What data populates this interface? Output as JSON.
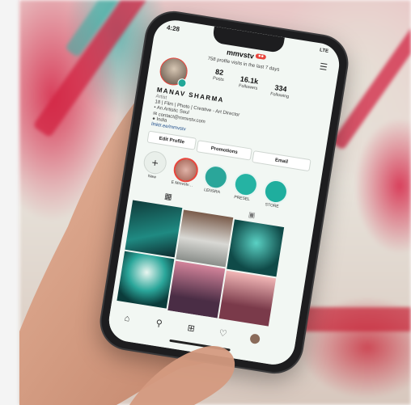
{
  "status_bar": {
    "time": "4:28",
    "signal": "LTE"
  },
  "app": {
    "title": "mmvstv",
    "dot_label": "●●"
  },
  "profile": {
    "visits_note": "758 profile visits in the last 7 days",
    "posts_count": "82",
    "posts_label": "Posts",
    "followers_count": "16.1k",
    "followers_label": "Followers",
    "following_count": "334",
    "following_label": "Following",
    "name": "MANAV SHARMA",
    "category": "Artist",
    "bio_line1": "18 | Film | Photo | Creative - Art Director",
    "bio_line2": "• An Artistic Soul",
    "bio_line3": "✉ contact@mmvstv.com",
    "bio_line4": "● India",
    "bio_link": "linktr.ee/mmvstv"
  },
  "buttons": {
    "edit": "Edit Profile",
    "promotions": "Promotions",
    "email": "Email"
  },
  "highlights": [
    {
      "label": "New",
      "color": "#e9efea"
    },
    {
      "label": "E Mmvstv…",
      "color": "#c98a7d"
    },
    {
      "label": "LENSRA",
      "color": "#2aa69a"
    },
    {
      "label": "PRESEL",
      "color": "#25b3a3"
    },
    {
      "label": "STORE",
      "color": "#1fae9e"
    }
  ],
  "colors": {
    "accent": "#e8453c",
    "teal": "#23a898"
  }
}
